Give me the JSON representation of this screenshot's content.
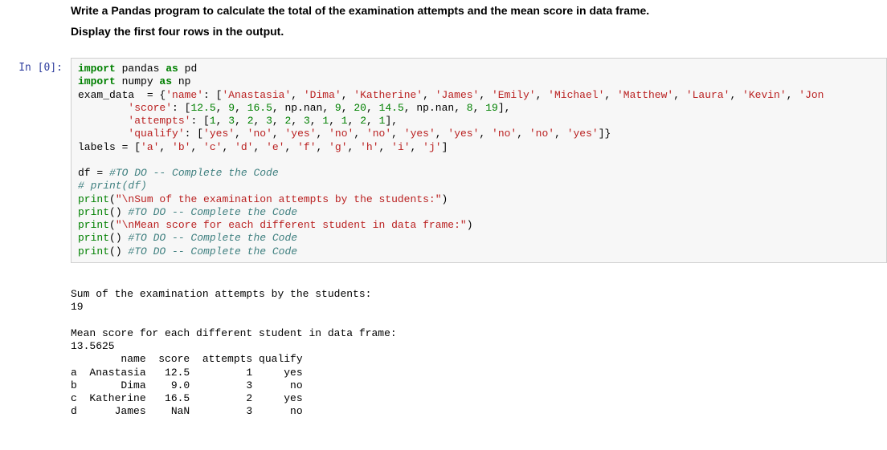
{
  "markdown": {
    "line1": "Write a Pandas program to calculate the total of the examination attempts and the mean score in data frame.",
    "line2": "Display the first four rows in the output."
  },
  "prompt": "In [0]:",
  "code": {
    "import1_a": "import",
    "import1_b": " pandas ",
    "import1_c": "as",
    "import1_d": " pd",
    "import2_a": "import",
    "import2_b": " numpy ",
    "import2_c": "as",
    "import2_d": " np",
    "l3_a": "exam_data  = {",
    "l3_b": "'name'",
    "l3_c": ": [",
    "l3_d": "'Anastasia'",
    "l3_e": ", ",
    "l3_f": "'Dima'",
    "l3_g": ", ",
    "l3_h": "'Katherine'",
    "l3_i": ", ",
    "l3_j": "'James'",
    "l3_k": ", ",
    "l3_l": "'Emily'",
    "l3_m": ", ",
    "l3_n": "'Michael'",
    "l3_o": ", ",
    "l3_p": "'Matthew'",
    "l3_q": ", ",
    "l3_r": "'Laura'",
    "l3_s": ", ",
    "l3_t": "'Kevin'",
    "l3_u": ", ",
    "l3_v": "'Jon",
    "l4_a": "        ",
    "l4_b": "'score'",
    "l4_c": ": [",
    "l4_d": "12.5",
    "l4_e": ", ",
    "l4_f": "9",
    "l4_g": ", ",
    "l4_h": "16.5",
    "l4_i": ", np.nan, ",
    "l4_j": "9",
    "l4_k": ", ",
    "l4_l": "20",
    "l4_m": ", ",
    "l4_n": "14.5",
    "l4_o": ", np.nan, ",
    "l4_p": "8",
    "l4_q": ", ",
    "l4_r": "19",
    "l4_s": "],",
    "l5_a": "        ",
    "l5_b": "'attempts'",
    "l5_c": ": [",
    "l5_d": "1",
    "l5_e": ", ",
    "l5_f": "3",
    "l5_g": ", ",
    "l5_h": "2",
    "l5_i": ", ",
    "l5_j": "3",
    "l5_k": ", ",
    "l5_l": "2",
    "l5_m": ", ",
    "l5_n": "3",
    "l5_o": ", ",
    "l5_p": "1",
    "l5_q": ", ",
    "l5_r": "1",
    "l5_s": ", ",
    "l5_t": "2",
    "l5_u": ", ",
    "l5_v": "1",
    "l5_w": "],",
    "l6_a": "        ",
    "l6_b": "'qualify'",
    "l6_c": ": [",
    "l6_d": "'yes'",
    "l6_e": ", ",
    "l6_f": "'no'",
    "l6_g": ", ",
    "l6_h": "'yes'",
    "l6_i": ", ",
    "l6_j": "'no'",
    "l6_k": ", ",
    "l6_l": "'no'",
    "l6_m": ", ",
    "l6_n": "'yes'",
    "l6_o": ", ",
    "l6_p": "'yes'",
    "l6_q": ", ",
    "l6_r": "'no'",
    "l6_s": ", ",
    "l6_t": "'no'",
    "l6_u": ", ",
    "l6_v": "'yes'",
    "l6_w": "]}",
    "l7_a": "labels = [",
    "l7_b": "'a'",
    "l7_c": ", ",
    "l7_d": "'b'",
    "l7_e": ", ",
    "l7_f": "'c'",
    "l7_g": ", ",
    "l7_h": "'d'",
    "l7_i": ", ",
    "l7_j": "'e'",
    "l7_k": ", ",
    "l7_l": "'f'",
    "l7_m": ", ",
    "l7_n": "'g'",
    "l7_o": ", ",
    "l7_p": "'h'",
    "l7_q": ", ",
    "l7_r": "'i'",
    "l7_s": ", ",
    "l7_t": "'j'",
    "l7_u": "]",
    "blank": "",
    "l9_a": "df = ",
    "l9_b": "#TO DO -- Complete the Code",
    "l10": "# print(df)",
    "l11_a": "print",
    "l11_b": "(",
    "l11_c": "\"\\nSum of the examination attempts by the students:\"",
    "l11_d": ")",
    "l12_a": "print",
    "l12_b": "() ",
    "l12_c": "#TO DO -- Complete the Code",
    "l13_a": "print",
    "l13_b": "(",
    "l13_c": "\"\\nMean score for each different student in data frame:\"",
    "l13_d": ")",
    "l14_a": "print",
    "l14_b": "() ",
    "l14_c": "#TO DO -- Complete the Code",
    "l15_a": "print",
    "l15_b": "() ",
    "l15_c": "#TO DO -- Complete the Code"
  },
  "output": "\nSum of the examination attempts by the students:\n19\n\nMean score for each different student in data frame:\n13.5625\n        name  score  attempts qualify\na  Anastasia   12.5         1     yes\nb       Dima    9.0         3      no\nc  Katherine   16.5         2     yes\nd      James    NaN         3      no"
}
